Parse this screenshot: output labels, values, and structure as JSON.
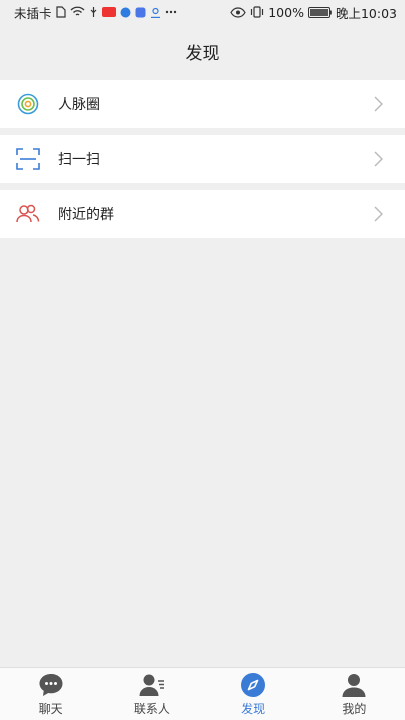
{
  "status_bar": {
    "carrier": "未插卡",
    "battery": "100%",
    "time": "晚上10:03"
  },
  "header": {
    "title": "发现"
  },
  "list": {
    "items": [
      {
        "label": "人脉圈",
        "icon": "contacts-circle-icon"
      },
      {
        "label": "扫一扫",
        "icon": "scan-icon"
      },
      {
        "label": "附近的群",
        "icon": "nearby-group-icon"
      }
    ]
  },
  "tabs": [
    {
      "label": "聊天",
      "icon": "chat-icon"
    },
    {
      "label": "联系人",
      "icon": "contacts-icon"
    },
    {
      "label": "发现",
      "icon": "compass-icon",
      "active": true
    },
    {
      "label": "我的",
      "icon": "profile-icon"
    }
  ],
  "colors": {
    "accent": "#3a7bd5",
    "background": "#efefef",
    "tab_inactive": "#555555",
    "nearby_icon": "#d9534f"
  }
}
